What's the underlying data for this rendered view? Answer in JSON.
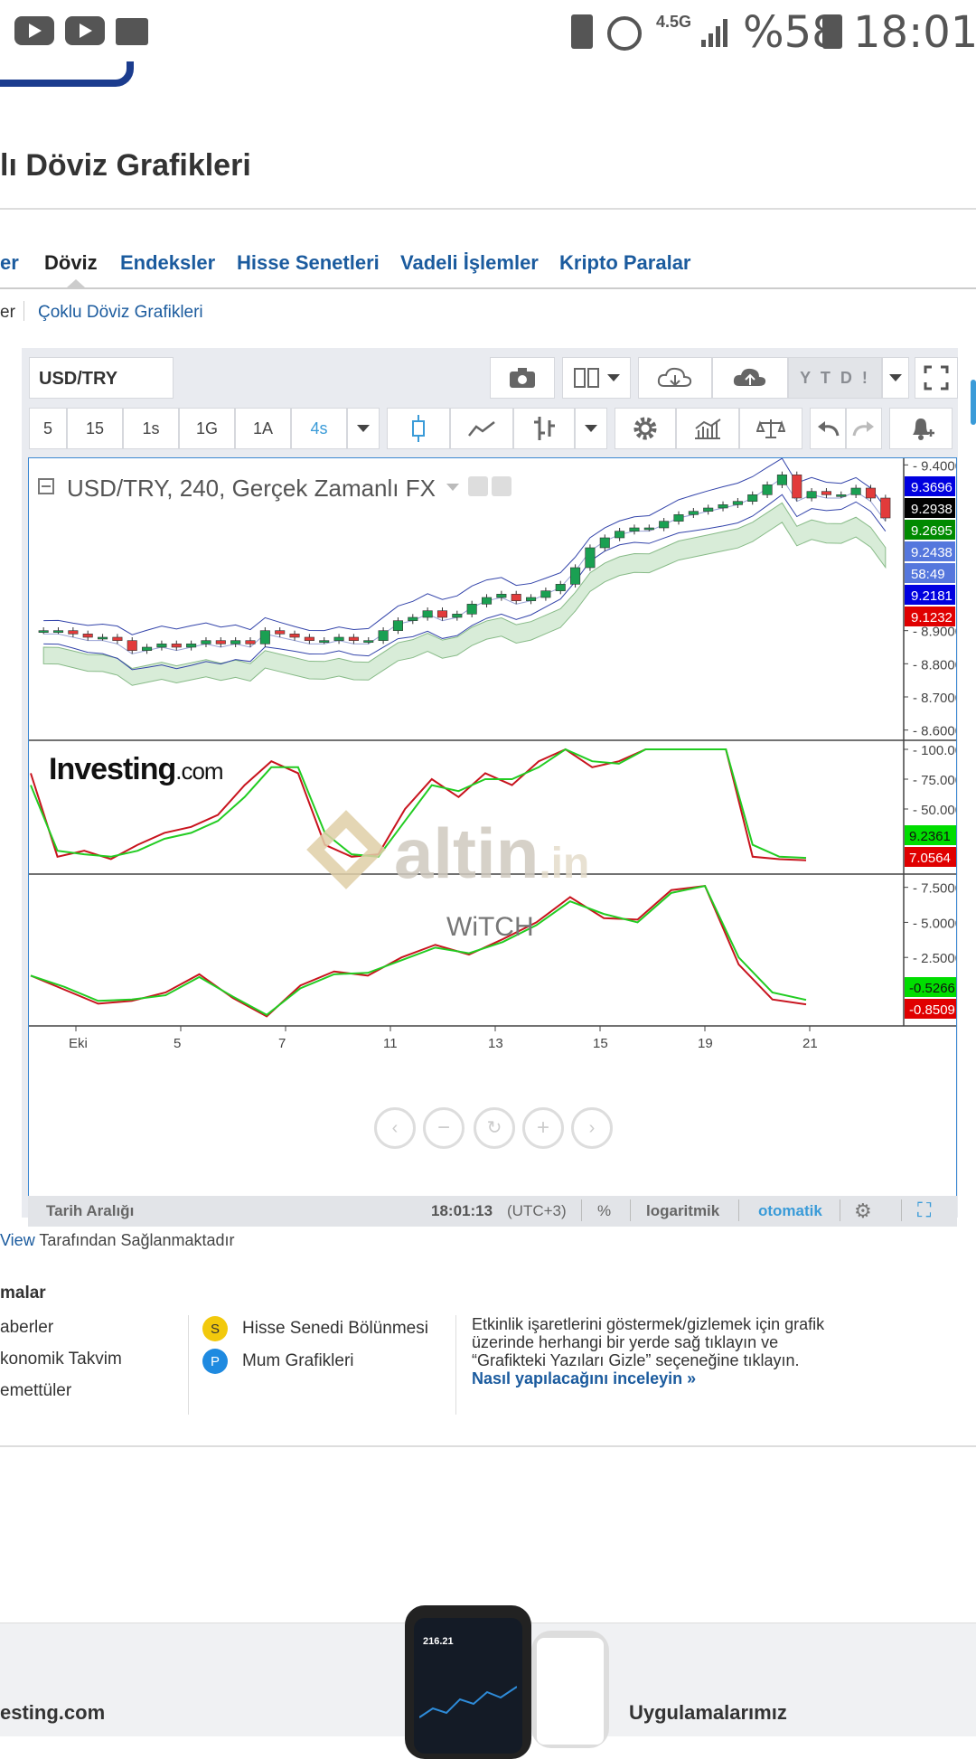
{
  "status_bar": {
    "network": "4.5G",
    "battery": "%58",
    "time": "18:01",
    "icons": [
      "youtube-icon",
      "youtube-icon",
      "folder-icon",
      "battery-saver-icon",
      "alarm-icon",
      "signal-icon",
      "battery-icon"
    ]
  },
  "page": {
    "title": "lı Döviz Grafikleri",
    "tabs": [
      "er",
      "Döviz",
      "Endeksler",
      "Hisse Senetleri",
      "Vadeli İşlemler",
      "Kripto Paralar"
    ],
    "active_tab": "Döviz",
    "subnav": [
      "er",
      "Çoklu Döviz Grafikleri"
    ]
  },
  "widget": {
    "symbol": "USD/TRY",
    "range_button": "Y T D !",
    "intervals": [
      "5",
      "15",
      "1s",
      "1G",
      "1A",
      "4s"
    ],
    "active_interval": "4s",
    "chart_title": "USD/TRY, 240, Gerçek Zamanlı FX",
    "watermark_brand": "Investing",
    "watermark_suffix": ".com",
    "overlay_brand": "altin",
    "overlay_suffix": ".in",
    "overlay_note": "WiTCH",
    "bottom": {
      "range_label": "Tarih Aralığı",
      "time": "18:01:13",
      "tz": "(UTC+3)",
      "percent": "%",
      "log": "logaritmik",
      "auto": "otomatik"
    },
    "accent_color": "#3a9bd8"
  },
  "chart_data": [
    {
      "type": "candlestick",
      "title": "USD/TRY, 240, Gerçek Zamanlı FX",
      "x_ticks": [
        "Eki",
        "5",
        "7",
        "11",
        "13",
        "15",
        "19",
        "21"
      ],
      "y_ticks": [
        "8.6000",
        "8.7000",
        "8.8000",
        "8.9000",
        "9.4000"
      ],
      "ylim": [
        8.58,
        9.42
      ],
      "price_labels": [
        {
          "value": "9.3696",
          "color": "#0000e0"
        },
        {
          "value": "9.2938",
          "color": "#000000"
        },
        {
          "value": "9.2695",
          "color": "#008a00"
        },
        {
          "value": "9.2438",
          "color": "#5577dd"
        },
        {
          "value": "58:49",
          "color": "#5577dd"
        },
        {
          "value": "9.2181",
          "color": "#0000e0"
        },
        {
          "value": "9.1232",
          "color": "#e00000"
        }
      ],
      "close": [
        8.9,
        8.9,
        8.89,
        8.88,
        8.88,
        8.87,
        8.84,
        8.85,
        8.86,
        8.85,
        8.86,
        8.87,
        8.86,
        8.87,
        8.86,
        8.9,
        8.89,
        8.88,
        8.87,
        8.87,
        8.88,
        8.87,
        8.87,
        8.9,
        8.93,
        8.94,
        8.96,
        8.94,
        8.95,
        8.98,
        9.0,
        9.01,
        8.99,
        9.0,
        9.02,
        9.04,
        9.09,
        9.15,
        9.18,
        9.2,
        9.21,
        9.21,
        9.23,
        9.25,
        9.26,
        9.27,
        9.28,
        9.29,
        9.31,
        9.34,
        9.37,
        9.3,
        9.32,
        9.31,
        9.31,
        9.33,
        9.3,
        9.24
      ]
    },
    {
      "type": "line",
      "y_ticks": [
        "100.0000",
        "75.0000",
        "50.0000"
      ],
      "ylim": [
        0,
        100
      ],
      "labels": [
        {
          "value": "9.2361",
          "color": "#00dd00"
        },
        {
          "value": "7.0564",
          "color": "#e00000"
        }
      ],
      "series": [
        {
          "values": [
            80,
            10,
            15,
            8,
            20,
            30,
            35,
            45,
            70,
            90,
            80,
            20,
            10,
            12,
            50,
            75,
            60,
            80,
            70,
            90,
            100,
            85,
            90,
            100,
            100,
            100,
            100,
            10,
            8,
            7
          ]
        },
        {
          "values": [
            70,
            15,
            12,
            10,
            15,
            25,
            30,
            40,
            60,
            85,
            85,
            30,
            12,
            10,
            40,
            70,
            65,
            75,
            75,
            85,
            100,
            90,
            88,
            100,
            100,
            100,
            100,
            20,
            10,
            9
          ]
        }
      ]
    },
    {
      "type": "line",
      "y_ticks": [
        "7.5000",
        "5.0000",
        "2.5000"
      ],
      "ylim": [
        -2,
        7.8
      ],
      "labels": [
        {
          "value": "-0.5266",
          "color": "#00dd00"
        },
        {
          "value": "-0.8509",
          "color": "#e00000"
        }
      ],
      "series": [
        {
          "values": [
            1.2,
            0.2,
            -0.8,
            -0.6,
            0.0,
            1.3,
            -0.4,
            -1.7,
            0.5,
            1.5,
            1.2,
            2.5,
            3.4,
            2.7,
            3.8,
            5.0,
            6.8,
            5.3,
            5.2,
            7.3,
            7.6,
            2.0,
            -0.5,
            -0.85
          ]
        },
        {
          "values": [
            1.2,
            0.4,
            -0.6,
            -0.5,
            -0.2,
            1.1,
            -0.3,
            -1.6,
            0.3,
            1.3,
            1.4,
            2.3,
            3.2,
            2.8,
            3.6,
            4.8,
            6.5,
            5.6,
            5.0,
            7.1,
            7.6,
            2.5,
            0.0,
            -0.53
          ]
        }
      ]
    }
  ],
  "below": {
    "provided_prefix": "View",
    "provided_text": "Tarafından Sağlanmaktadır",
    "section_title": "malar",
    "col1": [
      "aberler",
      "konomik Takvim",
      "emettüler"
    ],
    "col2": [
      {
        "badge": "S",
        "badge_color": "#f2c90c",
        "label": "Hisse Senedi Bölünmesi"
      },
      {
        "badge": "P",
        "badge_color": "#1f8ae0",
        "label": "Mum Grafikleri"
      }
    ],
    "note": "Etkinlik işaretlerini göstermek/gizlemek için grafik üzerinde herhangi bir yerde sağ tıklayın ve “Grafikteki Yazıları Gizle” seçeneğine tıklayın.",
    "note_link": "Nasıl yapılacağını inceleyin »"
  },
  "footer": {
    "left": "esting.com",
    "right": "Uygulamalarımız",
    "phone_price": "216.21"
  }
}
